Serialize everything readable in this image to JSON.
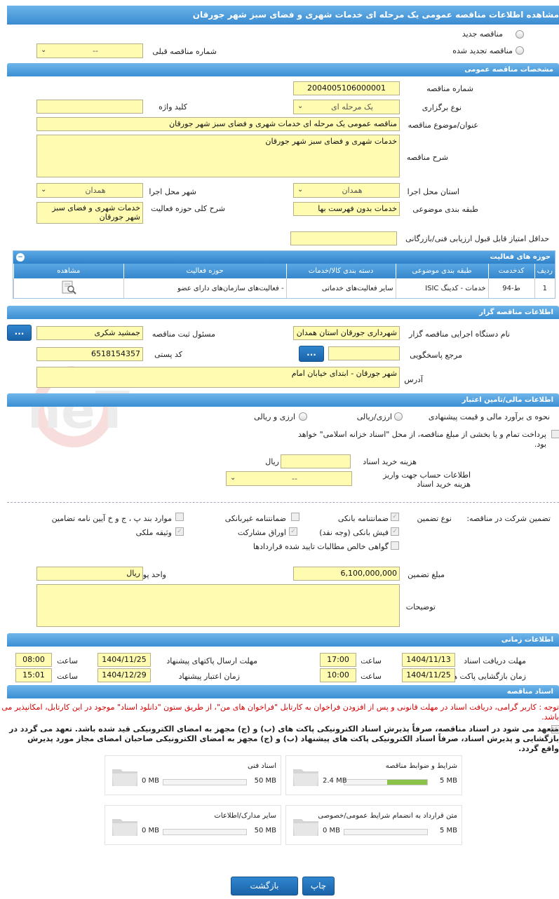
{
  "title": "مشاهده اطلاعات مناقصه عمومی یک مرحله ای خدمات شهری و فضای سبز شهر جورقان",
  "top": {
    "new_label": "مناقصه جدید",
    "renewed_label": "مناقصه تجدید شده",
    "prev_label": "شماره مناقصه قبلی",
    "prev_value": "--"
  },
  "general": {
    "header": "مشخصات مناقصه عمومی",
    "number_label": "شماره مناقصه",
    "number": "2004005106000001",
    "type_label": "نوع برگزاری",
    "type": "یک مرحله ای",
    "keyword_label": "کلید واژه",
    "keyword": "",
    "subject_label": "عنوان/موضوع مناقصه",
    "subject": "مناقصه عمومی یک مرحله ای خدمات شهری و فضای سبز شهر جورقان",
    "desc_label": "شرح مناقصه",
    "desc": "خدمات شهری و فضای سبز شهر جورقان",
    "province_label": "استان محل اجرا",
    "province": "همدان",
    "city_label": "شهر محل اجرا",
    "city": "همدان",
    "category_label": "طبقه بندی موضوعی",
    "category": "خدمات بدون فهرست بها",
    "scope_label": "شرح کلی حوزه فعالیت",
    "scope": "خدمات شهری و فضای سبز شهر جورقان",
    "minscore_label": "حداقل امتیاز قابل قبول ارزیابی فنی/بازرگانی",
    "minscore": ""
  },
  "activity": {
    "header": "حوزه های فعالیت",
    "toggle": "−",
    "columns": [
      "ردیف",
      "کدخدمت",
      "طبقه بندی موضوعی",
      "دسته بندی کالا/خدمات",
      "حوزه فعالیت",
      "مشاهده"
    ],
    "rows": [
      {
        "row": "1",
        "code": "ط-94",
        "category": "خدمات - کدینگ ISIC",
        "group": "سایر فعالیت‌های خدماتی",
        "field": "- فعالیت‌های سازمان‌های دارای عضو"
      }
    ]
  },
  "organizer": {
    "header": "اطلاعات مناقصه گزار",
    "org_label": "نام دستگاه اجرایی مناقصه گزار",
    "org": "شهرداری جورقان استان همدان",
    "resp_label": "مسئول ثبت مناقصه",
    "resp": "جمشید  شکری",
    "ref_label": "مرجع پاسخگویی",
    "ref": "",
    "postal_label": "کد پستی",
    "postal": "6518154357",
    "address_label": "آدرس",
    "address": "شهر جورقان - ابتدای خیابان امام",
    "more_btn": "...",
    "ref_btn": "..."
  },
  "finance": {
    "header": "اطلاعات مالی/تامین اعتبار",
    "estimate_label": "نحوه ی برآورد مالی و قیمت پیشنهادی",
    "opt1": "ارزی/ریالی",
    "opt2": "ارزی و ریالی",
    "treasury_text": "پرداخت تمام و یا بخشی از مبلغ مناقصه، از محل \"اسناد خزانه اسلامی\" خواهد بود.",
    "doc_cost_label": "هزینه خرید اسناد",
    "doc_cost_unit": "ریال",
    "doc_cost": "",
    "account_label": "اطلاعات حساب جهت واریز هزینه خرید اسناد",
    "account": "--"
  },
  "guarantee": {
    "label": "تضمین شرکت در مناقصه:",
    "type_label": "نوع تضمین",
    "items": [
      "ضمانتنامه بانکی",
      "ضمانتنامه غیربانکی",
      "موارد بند پ ، ج و خ آیین نامه تضامین",
      "فیش بانکی (وجه نقد)",
      "اوراق مشارکت",
      "وثیقه ملکی",
      "گواهی خالص مطالبات تایید شده قراردادها"
    ],
    "amount_label": "مبلغ تضمین",
    "amount": "6,100,000,000",
    "currency_label": "واحد پول",
    "currency": "ریال",
    "notes_label": "توضیحات",
    "notes": ""
  },
  "timing": {
    "header": "اطلاعات زمانی",
    "get_docs_label": "مهلت دریافت اسناد",
    "get_docs_date": "1404/11/13",
    "get_docs_time": "17:00",
    "submit_label": "مهلت ارسال پاکتهای پیشنهاد",
    "submit_date": "1404/11/25",
    "submit_time": "08:00",
    "open_label": "زمان بازگشایی پاکت ها",
    "open_date": "1404/11/25",
    "open_time": "10:00",
    "validity_label": "زمان اعتبار پیشنهاد",
    "validity_date": "1404/12/29",
    "validity_time": "15:01",
    "time_label": "ساعت"
  },
  "documents": {
    "header": "اسناد مناقصه",
    "notice": "توجه : کاربر گرامی، دریافت اسناد در مهلت قانونی و پس از افزودن فراخوان به کارتابل \"فراخوان های من\"، از طریق ستون \"دانلود اسناد\" موجود در این کارتابل، امکانپذیر می باشد.",
    "commit": "متعهد می شود در اسناد مناقصه، صرفاً پذیرش اسناد الکترونیکی پاکت های (ب) و (ج) مجهز به امضای الکترونیکی قید شده باشد. تعهد می گردد در بازگشایی و پذیرش اسناد، صرفاً اسناد الکترونیکی پاکت های پیشنهاد (ب) و (ج) مجهز به امضای الکترونیکی صاحبان امضای مجاز مورد پذیرش واقع گردد.",
    "files": [
      {
        "name": "شرایط و ضوابط مناقصه",
        "used": "2.4 MB",
        "max": "5 MB",
        "fill": 0.48
      },
      {
        "name": "اسناد فنی",
        "used": "0 MB",
        "max": "50 MB",
        "fill": 0
      },
      {
        "name": "متن قرارداد به انضمام شرایط عمومی/خصوصی",
        "used": "0 MB",
        "max": "5 MB",
        "fill": 0
      },
      {
        "name": "سایر مدارک/اطلاعات",
        "used": "0 MB",
        "max": "50 MB",
        "fill": 0
      }
    ]
  },
  "actions": {
    "back": "بازگشت",
    "print": "چاپ"
  }
}
